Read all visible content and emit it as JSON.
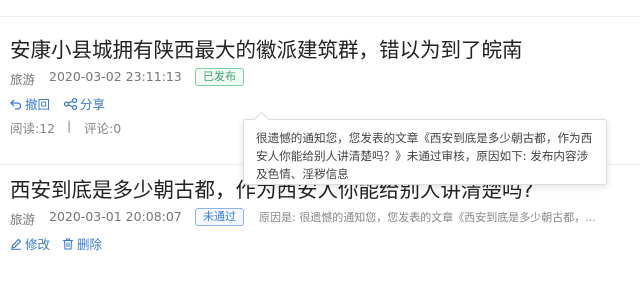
{
  "articles": [
    {
      "title": "安康小县城拥有陕西最大的徽派建筑群，错以为到了皖南",
      "category": "旅游",
      "time": "2020-03-02 23:11:13",
      "status": "已发布",
      "actions": {
        "undo": "撤回",
        "share": "分享"
      },
      "stats": {
        "reads": "阅读:12",
        "separator": "|",
        "comments": "评论:0"
      }
    },
    {
      "title": "西安到底是多少朝古都，作为西安人你能给别人讲清楚吗?",
      "category": "旅游",
      "time": "2020-03-01 20:08:07",
      "status": "未通过",
      "reason": "原因是: 很遗憾的通知您，您发表的文章《西安到底是多少朝古都，...",
      "actions": {
        "edit": "修改",
        "delete": "删除"
      }
    }
  ],
  "tooltip": {
    "text": "很遗憾的通知您，您发表的文章《西安到底是多少朝古都，作为西安人你能给别人讲清楚吗？》未通过审核，原因如下: 发布内容涉及色情、淫秽信息"
  },
  "colors": {
    "link": "#3b7bd1",
    "published": "#3aa66d",
    "rejected": "#3a7fd6"
  },
  "icons": {
    "undo": "undo-icon",
    "share": "share-icon",
    "edit": "edit-icon",
    "delete": "trash-icon"
  }
}
